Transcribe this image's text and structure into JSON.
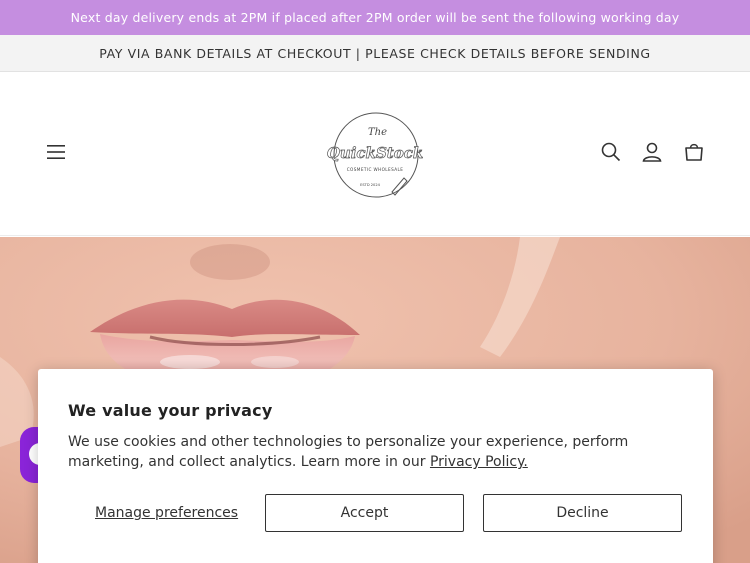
{
  "announcement_bar": {
    "text": "Next day delivery ends at 2PM if placed after 2PM order will be sent the following working day",
    "color": "#c58ee0"
  },
  "notice_bar": {
    "text": "PAY VIA BANK DETAILS AT CHECKOUT | PLEASE CHECK DETAILS BEFORE SENDING"
  },
  "header": {
    "logo": {
      "the": "The",
      "brand": "QuickStock",
      "tagline": "COSMETIC WHOLESALE",
      "est": "ESTD 2024"
    },
    "icons": [
      "menu-icon",
      "search-icon",
      "account-icon",
      "cart-icon"
    ]
  },
  "privacy_banner": {
    "title": "We value your privacy",
    "body": "We use cookies and other technologies to personalize your experience, perform marketing, and collect analytics. Learn more in our ",
    "link": "Privacy Policy.",
    "manage_label": "Manage preferences",
    "accept_label": "Accept",
    "decline_label": "Decline"
  },
  "chat_widget": {
    "icon": "chat-icon",
    "color": "#8a24d8"
  }
}
